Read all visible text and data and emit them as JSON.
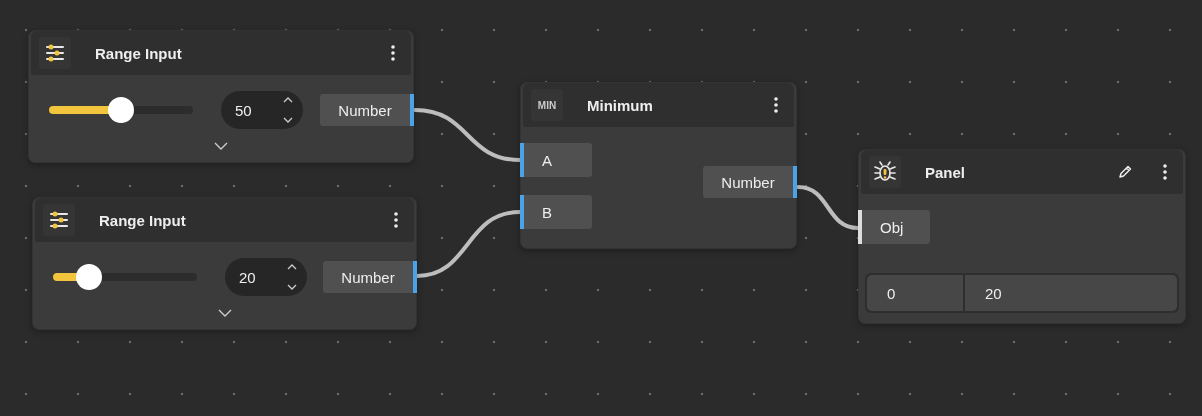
{
  "nodes": [
    {
      "kind": "range",
      "title": "Range Input",
      "level": 0.5,
      "value": "50",
      "output": "Number"
    },
    {
      "kind": "range",
      "title": "Range Input",
      "level": 0.25,
      "value": "20",
      "output": "Number"
    },
    {
      "kind": "minimum",
      "badge": "MIN",
      "title": "Minimum",
      "inputs": [
        "A",
        "B"
      ],
      "output": "Number"
    },
    {
      "kind": "panel",
      "title": "Panel",
      "input": "Obj",
      "cells": [
        "0",
        "20"
      ]
    }
  ]
}
